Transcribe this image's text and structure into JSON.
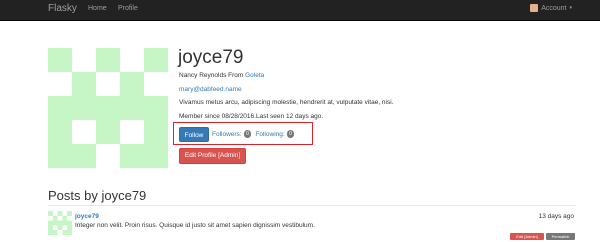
{
  "nav": {
    "brand": "Flasky",
    "links": [
      "Home",
      "Profile"
    ],
    "account_label": "Account",
    "account_caret": "▾"
  },
  "profile": {
    "username": "joyce79",
    "name_prefix": "Nancy Reynolds From",
    "location": "Goleta",
    "email": "mary@dabfeed.name",
    "about": "Vivamus metus arcu, adipiscing molestie, hendrerit at, vulputate vitae, nisi.",
    "member_since": "Member since 08/28/2016.Last seen 12 days ago.",
    "follow_label": "Follow",
    "followers_label": "Followers:",
    "followers_count": "0",
    "following_label": "Following:",
    "following_count": "0",
    "edit_admin_label": "Edit Profile [Admin]"
  },
  "posts_section": {
    "title": "Posts by joyce79",
    "posts": [
      {
        "author": "joyce79",
        "time": "13 days ago",
        "body": "Integer non velit. Proin risus. Quisque id justo sit amet sapien dignissim vestibulum.",
        "edit_label": "Edit [Admin]",
        "permalink_label": "Permalink"
      }
    ]
  },
  "colors": {
    "navbar": "#222222",
    "link": "#337ab7",
    "primary_button": "#337ab7",
    "danger_button": "#d9534f",
    "highlight_box": "#d9232d",
    "identicon": "#c6f5c6"
  }
}
